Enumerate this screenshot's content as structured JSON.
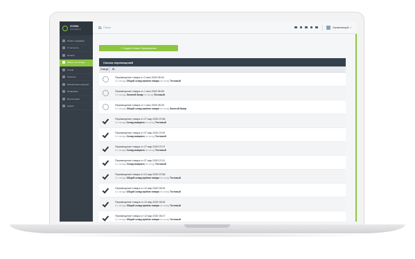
{
  "brand": {
    "name": "ZOOMA",
    "subtitle": "инструменты"
  },
  "sidebar": {
    "items": [
      {
        "label": "Начать продавца",
        "active": false,
        "has_caret": false
      },
      {
        "label": "Отчетность",
        "active": false,
        "has_caret": true
      },
      {
        "label": "Каталог",
        "active": false,
        "has_caret": true
      },
      {
        "label": "Работа на складе",
        "active": true,
        "has_caret": true
      },
      {
        "label": "Отзыв",
        "active": false,
        "has_caret": false
      },
      {
        "label": "Клиенты",
        "active": false,
        "has_caret": false
      },
      {
        "label": "Обновления модулей",
        "active": false,
        "has_caret": false
      },
      {
        "label": "Профайлы",
        "active": false,
        "has_caret": true
      },
      {
        "label": "Бухгалтерия",
        "active": false,
        "has_caret": true
      },
      {
        "label": "Админ",
        "active": false,
        "has_caret": true
      }
    ]
  },
  "topbar": {
    "search_placeholder": "Поиск",
    "user_name": "Управляющий"
  },
  "content": {
    "create_button": "+ Создать Новое Перемещение",
    "panel_title": "Список перемещений",
    "col_status": "Статус",
    "col_id": "ID"
  },
  "rows": [
    {
      "status": "pending",
      "title": "Перемещение товара от 2 июл 2020 06:44",
      "from_label": "Со склада",
      "from": "Общий склад приёма товара",
      "to_label": "на склад",
      "to": "Тестовый"
    },
    {
      "status": "pending",
      "title": "Перемещение товара от 1 июл 2020 06:59",
      "from_label": "Со склада",
      "from": "Золотой базар",
      "to_label": "на склад",
      "to": "Тестовый"
    },
    {
      "status": "pending",
      "title": "Перемещение товара от 1 июл 2020 05:25",
      "from_label": "Со склада",
      "from": "Общий склад приёма товара",
      "to_label": "на склад",
      "to": "Золотой базар"
    },
    {
      "status": "done",
      "title": "Перемещение товара от 27 мар 2020 07:56",
      "from_label": "Со склада",
      "from": "Склад возврата",
      "to_label": "на склад",
      "to": "Тестовый"
    },
    {
      "status": "done",
      "title": "Перемещение товара от 27 мар 2020 07:52",
      "from_label": "Со склада",
      "from": "Склад возврата",
      "to_label": "на склад",
      "to": "Тестовый"
    },
    {
      "status": "done",
      "title": "Перемещение товара от 27 мар 2020 07:47",
      "from_label": "Со склада",
      "from": "Склад возврата",
      "to_label": "на склад",
      "to": "Тестовый"
    },
    {
      "status": "done",
      "title": "Перемещение товара от 27 мар 2020 07:41",
      "from_label": "Со склада",
      "from": "Склад возврата",
      "to_label": "на склад",
      "to": "Тестовый"
    },
    {
      "status": "done",
      "title": "Перемещение товара от 21 мар 2020 07:58",
      "from_label": "Со склада",
      "from": "Общий склад приёма товара",
      "to_label": "на склад",
      "to": "Тестовый"
    },
    {
      "status": "done",
      "title": "Перемещение товара от 12 мар 2020 05:34",
      "from_label": "Со склада",
      "from": "Общий склад приёма товара",
      "to_label": "на склад",
      "to": "Тестовый"
    },
    {
      "status": "done",
      "title": "Перемещение товара от 12 мар 2020 05:30",
      "from_label": "Со склада",
      "from": "Общий склад приёма товара",
      "to_label": "на склад",
      "to": "Тестовый"
    },
    {
      "status": "done",
      "title": "Перемещение товара от 12 мар 2020 05:27",
      "from_label": "Со склада",
      "from": "Общий склад приёма товара",
      "to_label": "на склад",
      "to": "Тестовый"
    }
  ]
}
